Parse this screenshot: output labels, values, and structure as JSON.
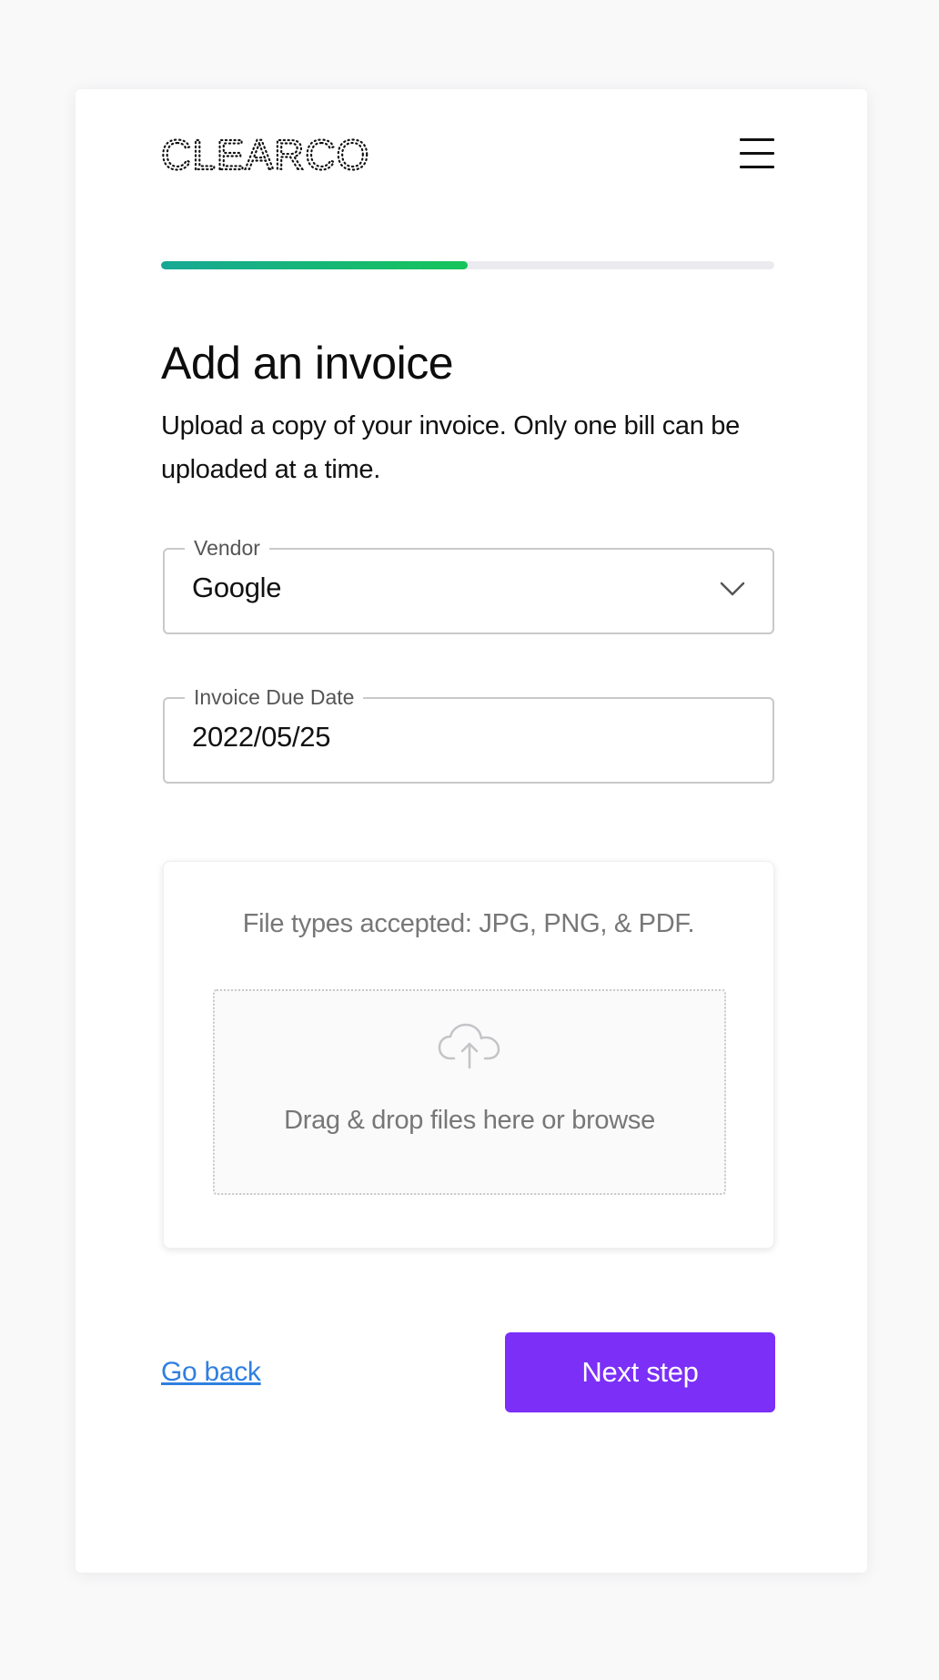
{
  "brand": {
    "logo_text": "CLEARCO"
  },
  "header": {
    "menu_icon": "hamburger-menu-icon"
  },
  "progress": {
    "fraction": 0.5,
    "color_start": "#17a895",
    "color_end": "#16c45a",
    "track_color": "#ebebef"
  },
  "main": {
    "title": "Add an invoice",
    "subtitle": "Upload a copy of your invoice. Only one bill can be uploaded at a time."
  },
  "form": {
    "vendor": {
      "label": "Vendor",
      "value": "Google",
      "icon": "chevron-down-icon"
    },
    "due_date": {
      "label": "Invoice Due Date",
      "value": "2022/05/25"
    }
  },
  "upload": {
    "accepted_types": "File types accepted: JPG, PNG, & PDF.",
    "dropzone_text": "Drag & drop files here or browse",
    "icon": "cloud-upload-icon"
  },
  "actions": {
    "back_label": "Go back",
    "next_label": "Next step",
    "link_color": "#2f7fe0",
    "button_color": "#7b2ff7"
  }
}
